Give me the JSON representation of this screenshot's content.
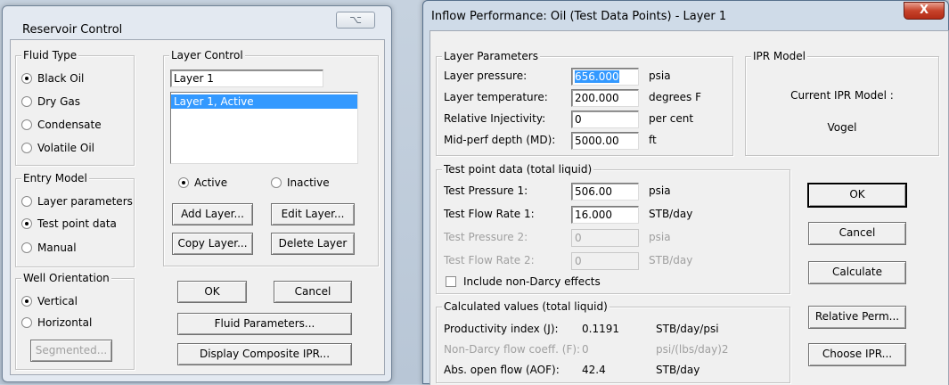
{
  "reservoir_control": {
    "title": "Reservoir Control",
    "close_symbol": "⌥",
    "fluid_type": {
      "label": "Fluid Type",
      "options": [
        {
          "label": "Black Oil",
          "selected": true
        },
        {
          "label": "Dry Gas",
          "selected": false
        },
        {
          "label": "Condensate",
          "selected": false
        },
        {
          "label": "Volatile Oil",
          "selected": false
        }
      ]
    },
    "layer_control": {
      "label": "Layer Control",
      "layer_name": "Layer 1",
      "list_items": [
        "Layer 1, Active"
      ],
      "active_label": "Active",
      "inactive_label": "Inactive",
      "add_layer": "Add Layer...",
      "edit_layer": "Edit Layer...",
      "copy_layer": "Copy Layer...",
      "delete_layer": "Delete Layer"
    },
    "entry_model": {
      "label": "Entry Model",
      "options": [
        {
          "label": "Layer parameters",
          "selected": false
        },
        {
          "label": "Test point data",
          "selected": true
        },
        {
          "label": "Manual",
          "selected": false
        }
      ]
    },
    "well_orientation": {
      "label": "Well Orientation",
      "options": [
        {
          "label": "Vertical",
          "selected": true
        },
        {
          "label": "Horizontal",
          "selected": false
        }
      ],
      "segmented": "Segmented..."
    },
    "ok": "OK",
    "cancel": "Cancel",
    "fluid_parameters": "Fluid Parameters...",
    "display_composite_ipr": "Display Composite IPR..."
  },
  "inflow": {
    "title": "Inflow Performance: Oil (Test Data Points) - Layer 1",
    "close_symbol": "X",
    "layer_parameters": {
      "label": "Layer Parameters",
      "rows": [
        {
          "label": "Layer pressure:",
          "value": "656.000",
          "unit": "psia"
        },
        {
          "label": "Layer temperature:",
          "value": "200.000",
          "unit": "degrees F"
        },
        {
          "label": "Relative Injectivity:",
          "value": "0",
          "unit": "per cent"
        },
        {
          "label": "Mid-perf depth (MD):",
          "value": "5000.00",
          "unit": "ft"
        }
      ]
    },
    "ipr_model": {
      "label": "IPR Model",
      "current_label": "Current IPR Model :",
      "current_value": "Vogel"
    },
    "test_point": {
      "label": "Test point data (total liquid)",
      "rows": [
        {
          "label": "Test Pressure 1:",
          "value": "506.00",
          "unit": "psia"
        },
        {
          "label": "Test Flow Rate 1:",
          "value": "16.000",
          "unit": "STB/day"
        },
        {
          "label": "Test Pressure 2:",
          "value": "0",
          "unit": "psia"
        },
        {
          "label": "Test Flow Rate 2:",
          "value": "0",
          "unit": "STB/day"
        }
      ],
      "non_darcy": "Include non-Darcy effects"
    },
    "calculated": {
      "label": "Calculated values (total liquid)",
      "rows": [
        {
          "label": "Productivity index (J):",
          "value": "0.1191",
          "unit": "STB/day/psi"
        },
        {
          "label": "Non-Darcy flow coeff. (F):",
          "value": "0",
          "unit": "psi/(lbs/day)2"
        },
        {
          "label": "Abs. open flow (AOF):",
          "value": "42.4",
          "unit": "STB/day"
        }
      ]
    },
    "buttons": {
      "ok": "OK",
      "cancel": "Cancel",
      "calculate": "Calculate",
      "relative_perm": "Relative Perm...",
      "choose_ipr": "Choose IPR..."
    }
  }
}
